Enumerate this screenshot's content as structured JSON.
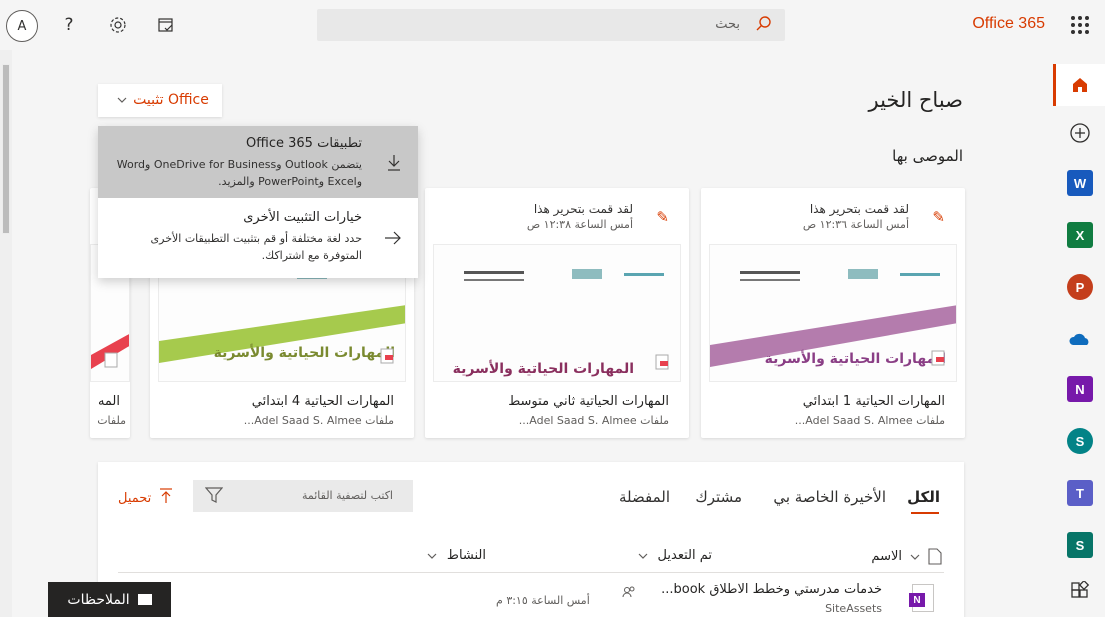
{
  "header": {
    "avatar_initial": "A",
    "search_placeholder": "بحث",
    "brand": "Office 365"
  },
  "main": {
    "greeting": "صباح الخير",
    "recommended_heading": "الموصى بها"
  },
  "install": {
    "button_label": "تثبيت Office",
    "items": [
      {
        "title": "تطبيقات Office 365",
        "description_line1": "يتضمن Outlook وOneDrive for Business وWord",
        "description_line2": "وExcel وPowerPoint والمزيد."
      },
      {
        "title": "خيارات التثبيت الأخرى",
        "description_line1": "حدد لغة مختلفة أو قم بتثبيت التطبيقات الأخرى",
        "description_line2": "المتوفرة مع اشتراكك."
      }
    ]
  },
  "cards": [
    {
      "activity": "لقد قمت بتحرير هذا",
      "time": "أمس الساعة ١٢:٣٦ ص",
      "title": "المهارات الحياتية 1 ابتدائي",
      "owner": "ملفات Adel Saad S. Almee...",
      "thumb_banner": "المهارات الحياتية والأسرية",
      "accent": "#a7659f"
    },
    {
      "activity": "لقد قمت بتحرير هذا",
      "time": "أمس الساعة ١٢:٣٨ ص",
      "title": "المهارات الحياتية ثاني متوسط",
      "owner": "ملفات Adel Saad S. Almee...",
      "thumb_banner": "المهارات الحياتية والأسرية",
      "accent": "#8a2f5e"
    },
    {
      "title": "المهارات الحياتية 4 ابتدائي",
      "owner": "ملفات Adel Saad S. Almee...",
      "thumb_banner": "المهارات الحياتية والأسرية",
      "accent": "#9cc43a"
    },
    {
      "title": "المه",
      "owner": "ملفات",
      "accent": "#e8414e"
    }
  ],
  "files": {
    "tabs": [
      "الكل",
      "الأخيرة الخاصة بي",
      "مشترك",
      "المفضلة"
    ],
    "filter_placeholder": "اكتب لتصفية القائمة",
    "upload_label": "تحميل",
    "columns": {
      "name": "الاسم",
      "modified": "تم التعديل",
      "activity": "النشاط"
    },
    "rows": [
      {
        "name": "خدمات مدرستي وخطط الاطلاق book...",
        "location": "SiteAssets",
        "modified": "أمس الساعة ٣:١٥ م"
      }
    ]
  },
  "feedback_label": "الملاحظات",
  "colors": {
    "accent": "#d83b01"
  },
  "rail_apps": [
    "home-icon",
    "create-icon",
    "word-icon",
    "excel-icon",
    "powerpoint-icon",
    "onedrive-icon",
    "onenote-icon",
    "sharepoint-icon",
    "teams-icon",
    "sway-icon",
    "all-apps-icon"
  ]
}
